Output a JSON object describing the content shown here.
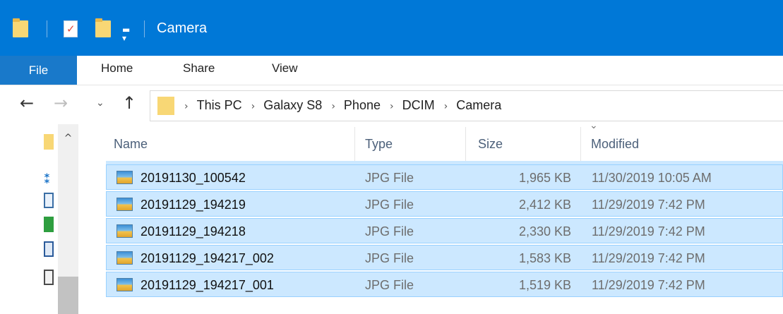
{
  "window": {
    "title": "Camera"
  },
  "ribbon": {
    "tabs": [
      "File",
      "Home",
      "Share",
      "View"
    ]
  },
  "address": {
    "crumbs": [
      "This PC",
      "Galaxy S8",
      "Phone",
      "DCIM",
      "Camera"
    ]
  },
  "columns": {
    "name": "Name",
    "type": "Type",
    "size": "Size",
    "modified": "Modified"
  },
  "files": [
    {
      "name": "20191130_100542",
      "type": "JPG File",
      "size": "1,965 KB",
      "modified": "11/30/2019 10:05 AM"
    },
    {
      "name": "20191129_194219",
      "type": "JPG File",
      "size": "2,412 KB",
      "modified": "11/29/2019 7:42 PM"
    },
    {
      "name": "20191129_194218",
      "type": "JPG File",
      "size": "2,330 KB",
      "modified": "11/29/2019 7:42 PM"
    },
    {
      "name": "20191129_194217_002",
      "type": "JPG File",
      "size": "1,583 KB",
      "modified": "11/29/2019 7:42 PM"
    },
    {
      "name": "20191129_194217_001",
      "type": "JPG File",
      "size": "1,519 KB",
      "modified": "11/29/2019 7:42 PM"
    }
  ],
  "colors": {
    "titlebar": "#0078d7",
    "file_tab": "#1979ca",
    "selection": "#cce8ff",
    "selection_border": "#99d1ff"
  }
}
